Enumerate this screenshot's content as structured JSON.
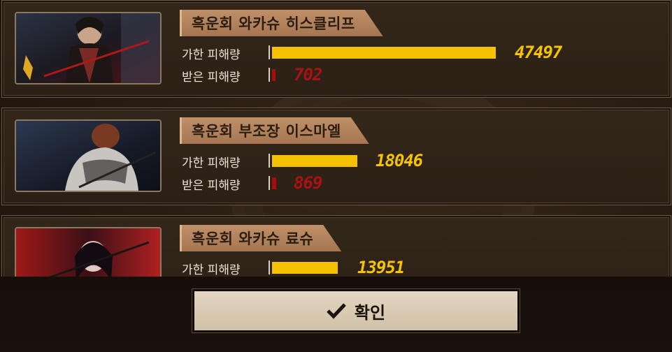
{
  "rows": [
    {
      "name": "흑운회 와카슈 히스클리프",
      "dealt_label": "가한 피해량",
      "taken_label": "받은 피해량",
      "dealt_value": "47497",
      "taken_value": "702",
      "dealt": 47497,
      "taken": 702
    },
    {
      "name": "흑운회 부조장 이스마엘",
      "dealt_label": "가한 피해량",
      "taken_label": "받은 피해량",
      "dealt_value": "18046",
      "taken_value": "869",
      "dealt": 18046,
      "taken": 869
    },
    {
      "name": "흑운회 와카슈 료슈",
      "dealt_label": "가한 피해량",
      "dealt_value": "13951",
      "dealt": 13951
    }
  ],
  "max_dealt": 47497,
  "confirm_label": "확인",
  "colors": {
    "dealt_bar": "#f4c200",
    "taken_bar": "#a80c0c",
    "title_tag": "#b2835c"
  }
}
